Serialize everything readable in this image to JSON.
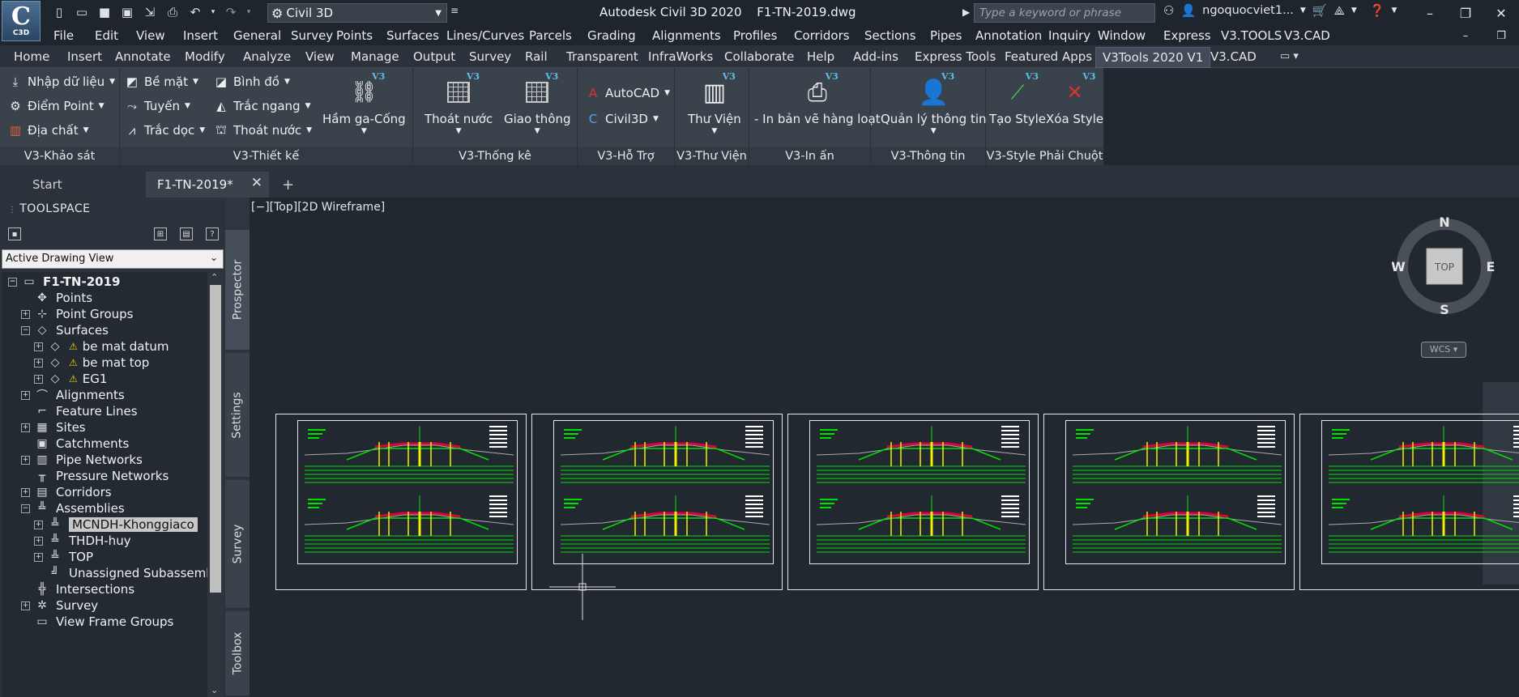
{
  "app": {
    "logo_big": "C",
    "logo_small": "C3D",
    "workspace": "Civil 3D",
    "title": "Autodesk Civil 3D 2020",
    "file": "F1-TN-2019.dwg",
    "search_placeholder": "Type a keyword or phrase",
    "user": "ngoquocviet1..."
  },
  "menu": [
    "File",
    "Edit",
    "View",
    "Insert",
    "General",
    "Survey",
    "Points",
    "Surfaces",
    "Lines/Curves",
    "Parcels",
    "Grading",
    "Alignments",
    "Profiles",
    "Corridors",
    "Sections",
    "Pipes",
    "Annotation",
    "Inquiry",
    "Window",
    "Express",
    "V3.TOOLS",
    "V3.CAD"
  ],
  "ribbon_tabs": [
    "Home",
    "Insert",
    "Annotate",
    "Modify",
    "Analyze",
    "View",
    "Manage",
    "Output",
    "Survey",
    "Rail",
    "Transparent",
    "InfraWorks",
    "Collaborate",
    "Help",
    "Add-ins",
    "Express Tools",
    "Featured Apps",
    "V3Tools 2020 V1",
    "V3.CAD"
  ],
  "ribbon": {
    "panels": {
      "khao_sat": "V3-Khảo sát",
      "thiet_ke": "V3-Thiết kế",
      "thong_ke": "V3-Thống kê",
      "ho_tro": "V3-Hỗ Trợ",
      "thu_vien": "V3-Thư Viện",
      "in_an": "V3-In ấn",
      "thong_tin": "V3-Thông tin",
      "style": "V3-Style Phải Chuột"
    },
    "buttons": {
      "nhap_du_lieu": "Nhập dữ liệu",
      "diem_point": "Điểm Point",
      "dia_chat": "Địa chất",
      "be_mat": "Bề mặt",
      "tuyen": "Tuyến",
      "trac_doc": "Trắc dọc",
      "binh_do": "Bình đồ",
      "trac_ngang": "Trắc ngang",
      "thoat_nuoc_small": "Thoát nước",
      "ham_ga_cong": "Hầm ga-Cống",
      "thoat_nuoc": "Thoát nước",
      "giao_thong": "Giao thông",
      "autocad": "AutoCAD",
      "civil3d": "Civil3D",
      "thu_vien": "Thư Viện",
      "in_ban_ve": "- In bản vẽ hàng loạt",
      "quan_ly": "Quản lý thông tin",
      "tao_style": "Tạo Style",
      "xoa_style": "Xóa Style"
    },
    "v3_badge": "V3"
  },
  "doc_tabs": {
    "start": "Start",
    "drawing": "F1-TN-2019*"
  },
  "toolspace": {
    "title": "TOOLSPACE",
    "view": "Active Drawing View",
    "tree": [
      {
        "label": "F1-TN-2019",
        "indent": 0,
        "pm": "−",
        "icon": "▭"
      },
      {
        "label": "Points",
        "indent": 1,
        "pm": "",
        "icon": "✥"
      },
      {
        "label": "Point Groups",
        "indent": 1,
        "pm": "+",
        "icon": "⊹"
      },
      {
        "label": "Surfaces",
        "indent": 1,
        "pm": "−",
        "icon": "◇"
      },
      {
        "label": "be mat datum",
        "indent": 2,
        "pm": "+",
        "icon": "◇",
        "warn": true
      },
      {
        "label": "be mat top",
        "indent": 2,
        "pm": "+",
        "icon": "◇",
        "warn": true
      },
      {
        "label": "EG1",
        "indent": 2,
        "pm": "+",
        "icon": "◇",
        "warn": true
      },
      {
        "label": "Alignments",
        "indent": 1,
        "pm": "+",
        "icon": "⌒"
      },
      {
        "label": "Feature Lines",
        "indent": 1,
        "pm": "",
        "icon": "⌐"
      },
      {
        "label": "Sites",
        "indent": 1,
        "pm": "+",
        "icon": "▦"
      },
      {
        "label": "Catchments",
        "indent": 1,
        "pm": "",
        "icon": "▣"
      },
      {
        "label": "Pipe Networks",
        "indent": 1,
        "pm": "+",
        "icon": "▥"
      },
      {
        "label": "Pressure Networks",
        "indent": 1,
        "pm": "",
        "icon": "╥"
      },
      {
        "label": "Corridors",
        "indent": 1,
        "pm": "+",
        "icon": "▤"
      },
      {
        "label": "Assemblies",
        "indent": 1,
        "pm": "−",
        "icon": "╩"
      },
      {
        "label": "MCNDH-Khonggiaco",
        "indent": 2,
        "pm": "+",
        "icon": "╩",
        "selected": true
      },
      {
        "label": "THDH-huy",
        "indent": 2,
        "pm": "+",
        "icon": "╩"
      },
      {
        "label": "TOP",
        "indent": 2,
        "pm": "+",
        "icon": "╩"
      },
      {
        "label": "Unassigned Subassemb...",
        "indent": 2,
        "pm": "",
        "icon": "╝"
      },
      {
        "label": "Intersections",
        "indent": 1,
        "pm": "",
        "icon": "╬"
      },
      {
        "label": "Survey",
        "indent": 1,
        "pm": "+",
        "icon": "✲"
      },
      {
        "label": "View Frame Groups",
        "indent": 1,
        "pm": "",
        "icon": "▭"
      }
    ]
  },
  "side_tabs": [
    "Prospector",
    "Settings",
    "Survey",
    "Toolbox"
  ],
  "viewport": {
    "label": "[−][Top][2D Wireframe]",
    "compass": {
      "n": "N",
      "s": "S",
      "e": "E",
      "w": "W",
      "face": "TOP"
    },
    "wcs": "WCS"
  },
  "colors": {
    "accent": "#58c0e8",
    "grid_green": "#00e000",
    "road_red": "#e0003c",
    "road_yellow": "#f0f000"
  }
}
